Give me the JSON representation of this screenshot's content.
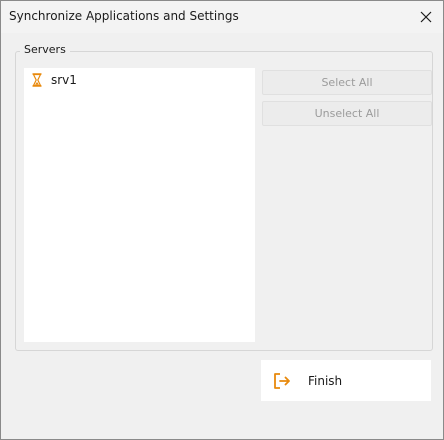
{
  "window": {
    "title": "Synchronize Applications and Settings",
    "close_icon": "close-icon"
  },
  "servers_group": {
    "legend": "Servers",
    "items": [
      {
        "label": "srv1",
        "icon": "hourglass-icon"
      }
    ]
  },
  "actions": {
    "select_all": "Select All",
    "unselect_all": "Unselect All",
    "finish": "Finish",
    "finish_icon": "exit-arrow-icon"
  },
  "colors": {
    "accent": "#e8890c",
    "window_bg": "#f0f0f0",
    "disabled_text": "#9b9b9b"
  }
}
